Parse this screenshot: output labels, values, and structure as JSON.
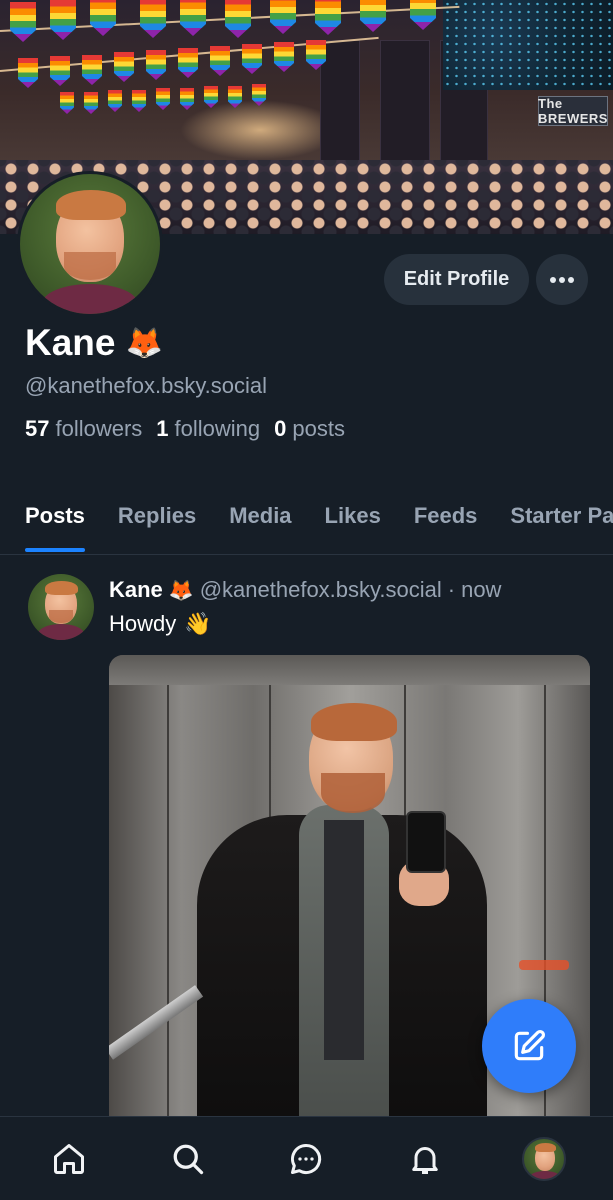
{
  "profile": {
    "display_name": "Kane",
    "name_emoji": "🦊",
    "handle": "@kanethefox.bsky.social",
    "stats": {
      "followers_count": "57",
      "followers_label": "followers",
      "following_count": "1",
      "following_label": "following",
      "posts_count": "0",
      "posts_label": "posts"
    },
    "banner_sign": "The BREWERS"
  },
  "actions": {
    "edit_profile": "Edit Profile",
    "more": "···"
  },
  "tabs": [
    {
      "label": "Posts",
      "active": true
    },
    {
      "label": "Replies",
      "active": false
    },
    {
      "label": "Media",
      "active": false
    },
    {
      "label": "Likes",
      "active": false
    },
    {
      "label": "Feeds",
      "active": false
    },
    {
      "label": "Starter Packs",
      "active": false
    }
  ],
  "post": {
    "author": "Kane",
    "author_emoji": "🦊",
    "handle": "@kanethefox.bsky.social",
    "separator": "·",
    "time": "now",
    "text": "Howdy",
    "text_emoji": "👋"
  },
  "bottom_nav": {
    "items": [
      "home-icon",
      "search-icon",
      "chat-icon",
      "bell-icon",
      "profile-avatar"
    ]
  },
  "colors": {
    "background": "#161e27",
    "accent": "#1c83ff",
    "fab": "#2f7dfa",
    "muted_text": "#98a4b3",
    "button_bg": "#27313c"
  }
}
